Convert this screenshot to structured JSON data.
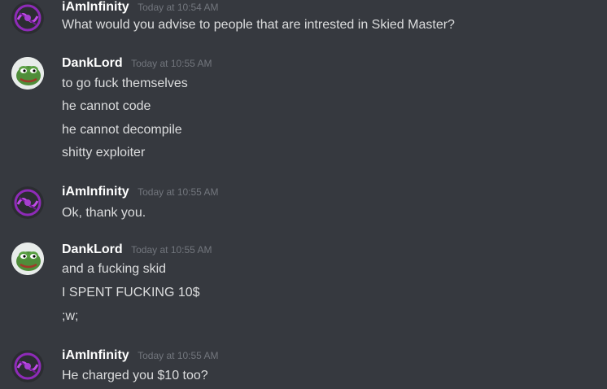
{
  "messages": [
    {
      "author": "iAmInfinity",
      "avatar": "infinity-logo-icon",
      "timestamp": "Today at 10:54 AM",
      "lines": [
        "What would you advise to people that are intrested in Skied Master?"
      ]
    },
    {
      "author": "DankLord",
      "avatar": "pepe-frog-icon",
      "timestamp": "Today at 10:55 AM",
      "lines": [
        "to go fuck themselves",
        "he cannot code",
        "he cannot decompile",
        "shitty exploiter"
      ]
    },
    {
      "author": "iAmInfinity",
      "avatar": "infinity-logo-icon",
      "timestamp": "Today at 10:55 AM",
      "lines": [
        "Ok, thank you."
      ]
    },
    {
      "author": "DankLord",
      "avatar": "pepe-frog-icon",
      "timestamp": "Today at 10:55 AM",
      "lines": [
        "and a fucking skid",
        "I SPENT FUCKING 10$",
        ";w;"
      ]
    },
    {
      "author": "iAmInfinity",
      "avatar": "infinity-logo-icon",
      "timestamp": "Today at 10:55 AM",
      "lines": [
        "He charged you $10 too?"
      ]
    }
  ],
  "colors": {
    "background": "#36393f",
    "username": "#ffffff",
    "timestamp": "#72767d",
    "message_text": "#dcddde"
  }
}
